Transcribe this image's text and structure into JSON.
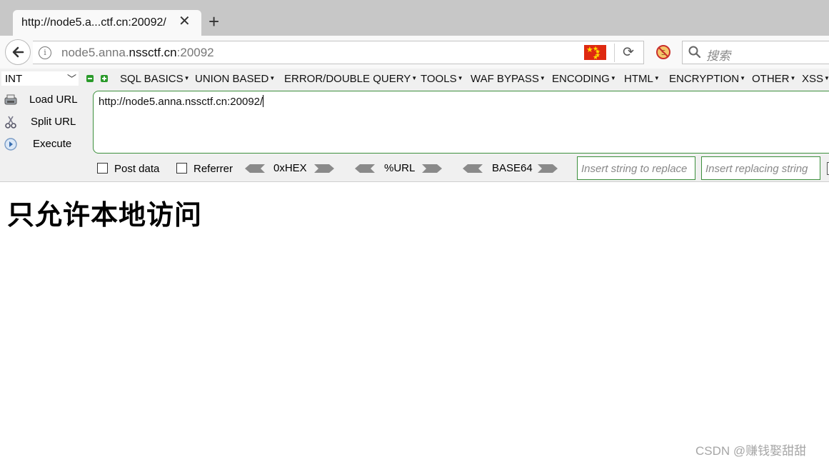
{
  "browser": {
    "tab": {
      "title": "http://node5.a...ctf.cn:20092/",
      "close_glyph": "✕"
    },
    "new_tab_glyph": "+",
    "address": {
      "prefix": "node5.anna.",
      "host": "nssctf.cn",
      "port": ":20092",
      "info_glyph": "i"
    },
    "search": {
      "placeholder": "搜索"
    },
    "icons": [
      "back-arrow-icon",
      "info-icon",
      "china-flag-icon",
      "reload-icon",
      "noscript-icon",
      "search-icon"
    ]
  },
  "hackbar": {
    "select": {
      "value": "INT"
    },
    "menu": [
      "SQL BASICS",
      "UNION BASED",
      "ERROR/DOUBLE QUERY",
      "TOOLS",
      "WAF BYPASS",
      "ENCODING",
      "HTML",
      "ENCRYPTION",
      "OTHER",
      "XSS"
    ],
    "side_buttons": {
      "load": "Load URL",
      "split": "Split URL",
      "execute": "Execute"
    },
    "url_value": "http://node5.anna.nssctf.cn:20092/",
    "post_data_label": "Post data",
    "referrer_label": "Referrer",
    "encoders": {
      "hex": "0xHEX",
      "url": "%URL",
      "base64": "BASE64"
    },
    "replace_placeholder": "Insert string to replace",
    "replacing_placeholder": "Insert replacing string"
  },
  "page": {
    "heading": "只允许本地访问",
    "watermark": "CSDN @赚钱娶甜甜"
  },
  "colors": {
    "tabstrip": "#c7c7c7",
    "hackbar_border": "#3c8f3c",
    "flag_red": "#de2910"
  }
}
